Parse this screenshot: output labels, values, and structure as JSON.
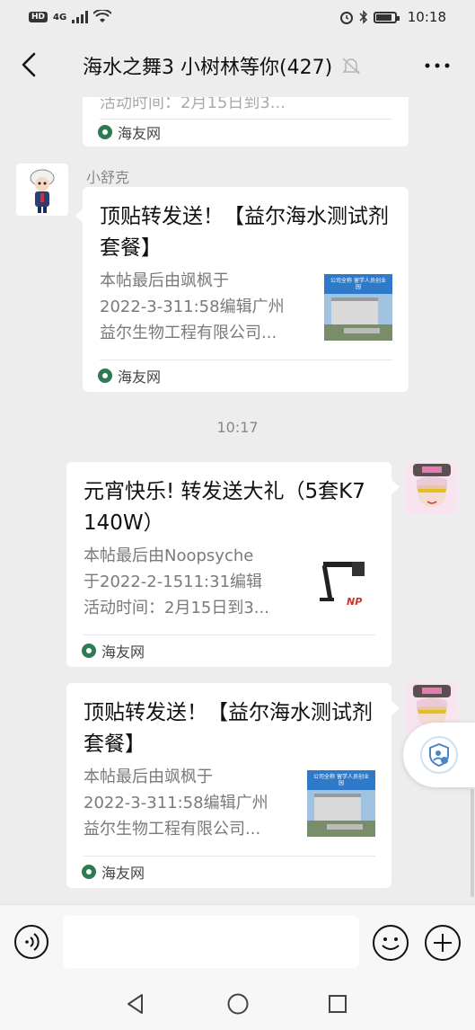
{
  "status_bar": {
    "left_badge": "HD",
    "signal": "4G",
    "time": "10:18"
  },
  "header": {
    "title": "海水之舞3 小树林等你(427)"
  },
  "messages": {
    "top_card": {
      "partial_line": "活动时间：2月15日到3...",
      "source": "海友网"
    },
    "msg1": {
      "sender": "小舒克",
      "title": "顶贴转发送！【益尔海水测试剂套餐】",
      "desc": [
        "本帖最后由飒枫于",
        "2022-3-311:58编辑广州",
        "益尔生物工程有限公司..."
      ],
      "thumb_text": "公司全称 留学人员创业园",
      "source": "海友网"
    },
    "timestamp": "10:17",
    "msg2": {
      "title": "元宵快乐! 转发送大礼（5套K7  140W）",
      "desc": [
        "本帖最后由Noopsyche",
        "于2022-2-1511:31编辑",
        "活动时间：2月15日到3..."
      ],
      "thumb_text": "NP",
      "source": "海友网"
    },
    "msg3": {
      "title": "顶贴转发送！【益尔海水测试剂套餐】",
      "desc": [
        "本帖最后由飒枫于",
        "2022-3-311:58编辑广州",
        "益尔生物工程有限公司..."
      ],
      "thumb_text": "公司全称 留学人员创业园",
      "source": "海友网"
    }
  },
  "input": {
    "value": "",
    "placeholder": ""
  },
  "colors": {
    "background": "#ededed",
    "card": "#ffffff",
    "source_logo": "#2e7a53",
    "accent_blue": "#4a86c8"
  }
}
